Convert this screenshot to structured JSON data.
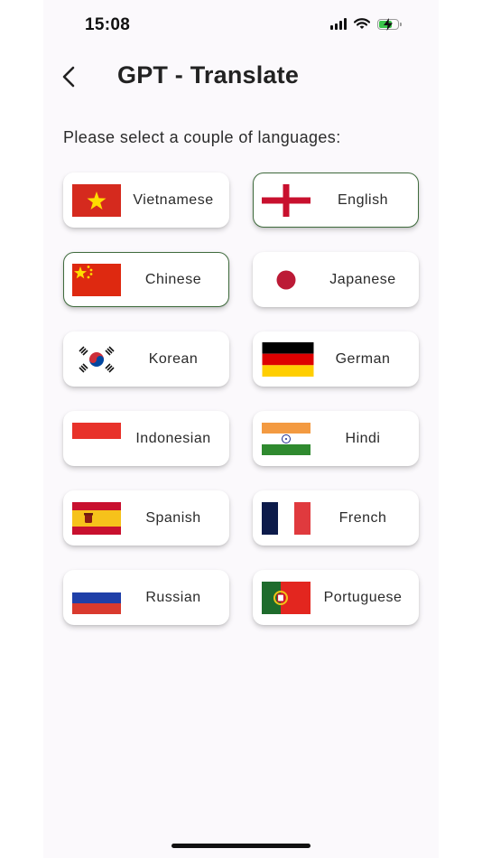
{
  "status": {
    "time": "15:08"
  },
  "header": {
    "title": "GPT - Translate"
  },
  "instruction": "Please select a couple of languages:",
  "languages": [
    {
      "label": "Vietnamese",
      "flag": "vietnam-flag-icon",
      "selected": false
    },
    {
      "label": "English",
      "flag": "england-flag-icon",
      "selected": true
    },
    {
      "label": "Chinese",
      "flag": "china-flag-icon",
      "selected": true
    },
    {
      "label": "Japanese",
      "flag": "japan-flag-icon",
      "selected": false
    },
    {
      "label": "Korean",
      "flag": "korea-flag-icon",
      "selected": false
    },
    {
      "label": "German",
      "flag": "germany-flag-icon",
      "selected": false
    },
    {
      "label": "Indonesian",
      "flag": "indonesia-flag-icon",
      "selected": false
    },
    {
      "label": "Hindi",
      "flag": "india-flag-icon",
      "selected": false
    },
    {
      "label": "Spanish",
      "flag": "spain-flag-icon",
      "selected": false
    },
    {
      "label": "French",
      "flag": "france-flag-icon",
      "selected": false
    },
    {
      "label": "Russian",
      "flag": "russia-flag-icon",
      "selected": false
    },
    {
      "label": "Portuguese",
      "flag": "portugal-flag-icon",
      "selected": false
    }
  ],
  "colors": {
    "selected_border": "#3f6b3d",
    "battery_fill": "#3ac44a"
  }
}
